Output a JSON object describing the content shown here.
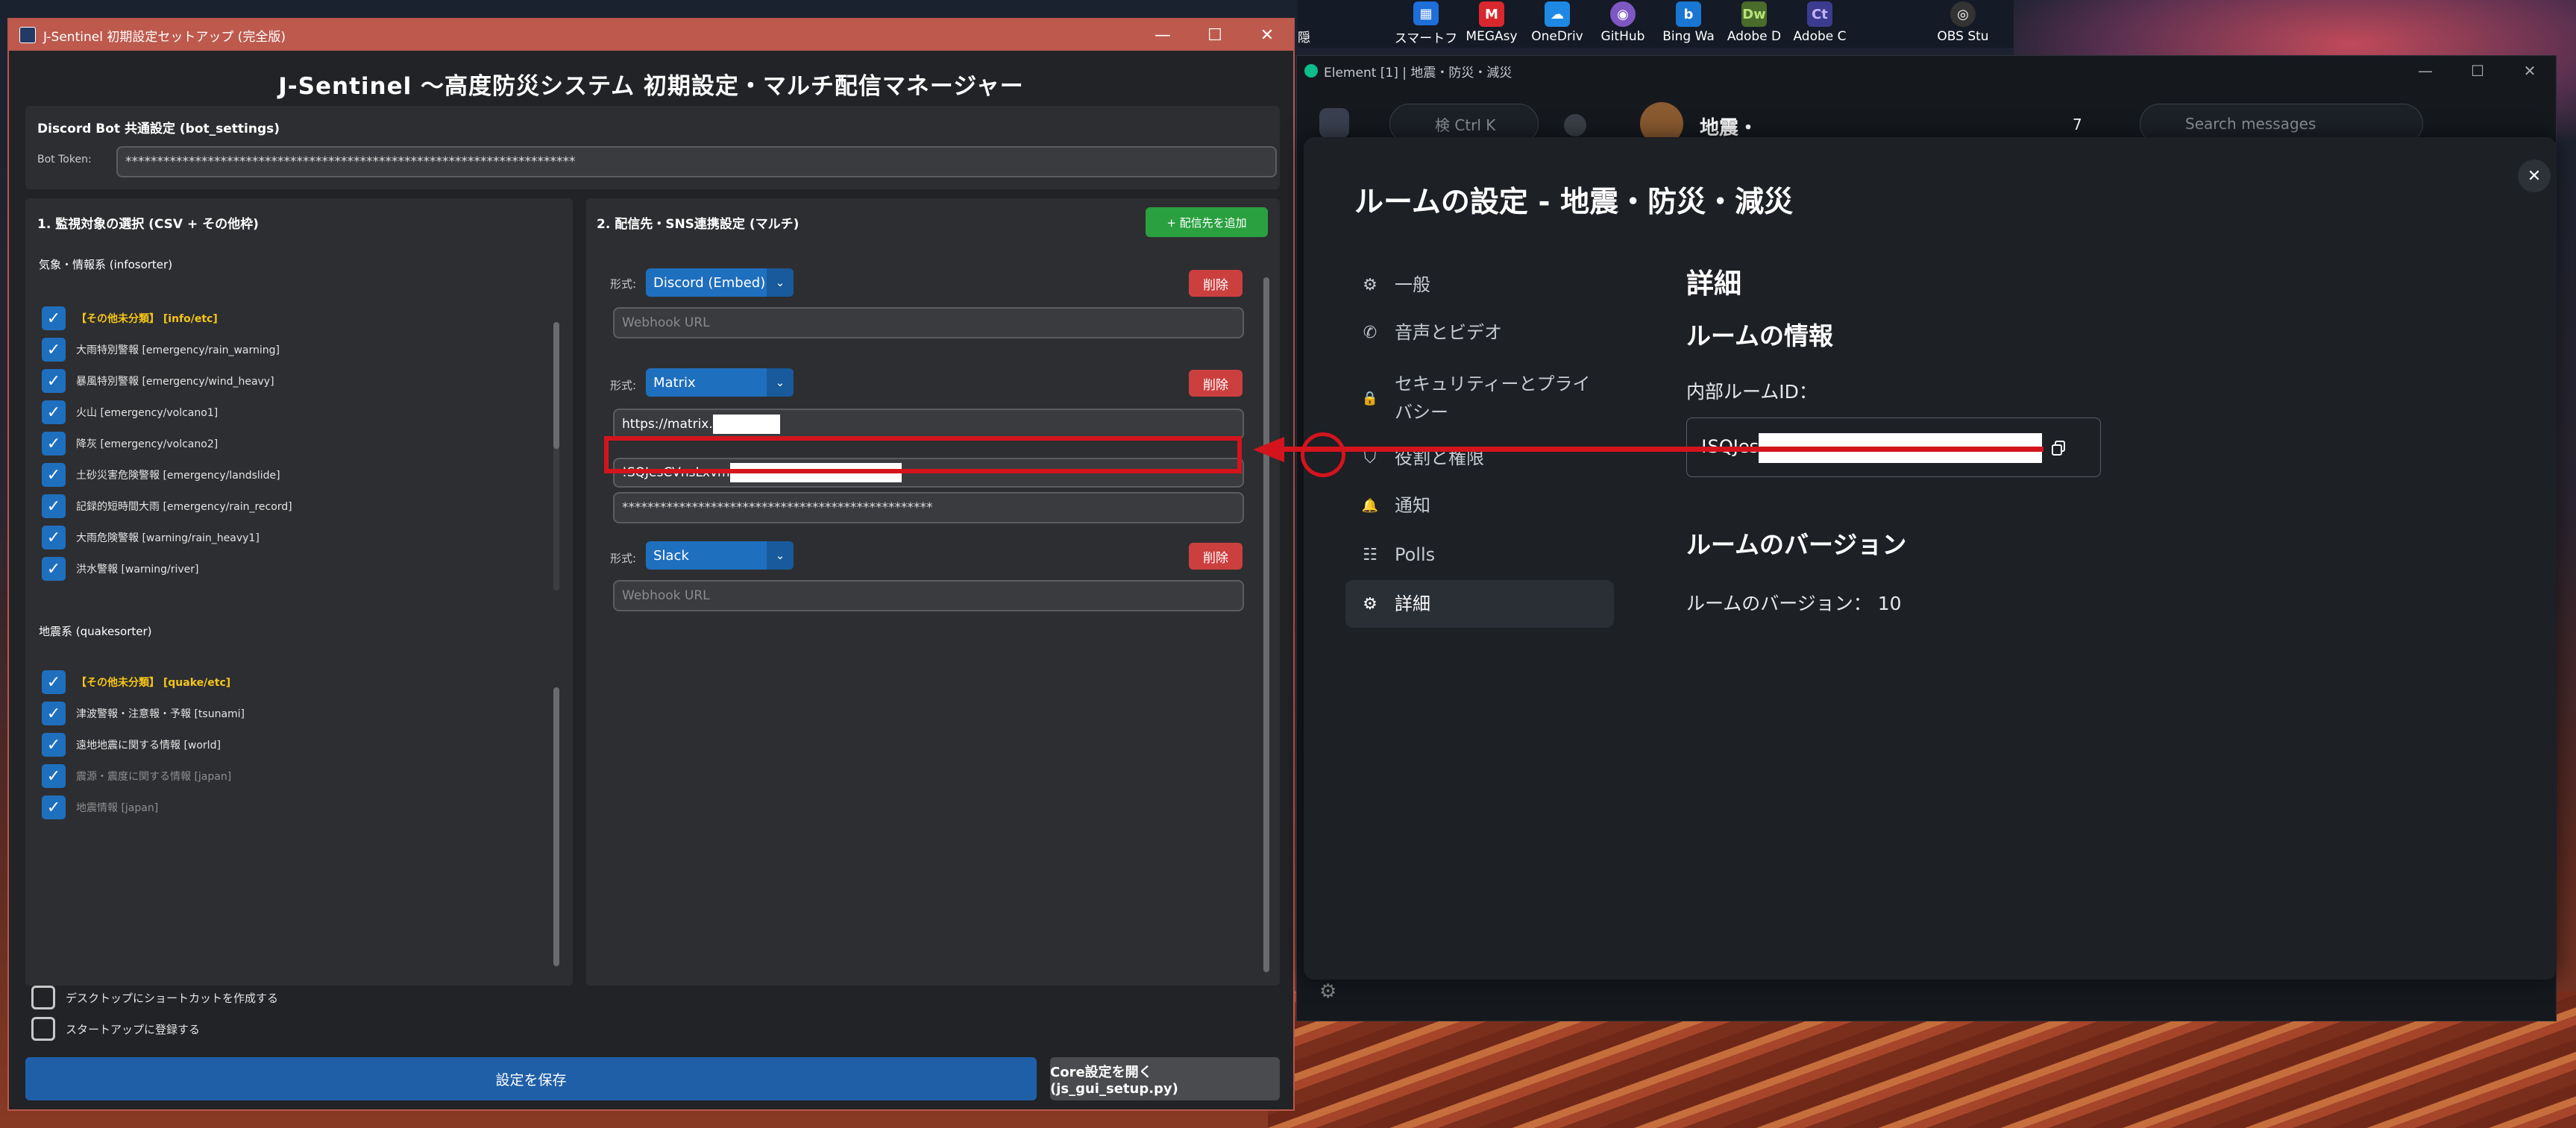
{
  "taskbar": {
    "items": [
      {
        "label": "スマートフ",
        "icon": "smartphone-app-icon",
        "color": "#1e6fd9"
      },
      {
        "label": "MEGAsy",
        "icon": "mega-icon",
        "color": "#d9272e"
      },
      {
        "label": "OneDriv",
        "icon": "onedrive-icon",
        "color": "#1e88e5"
      },
      {
        "label": "GitHub",
        "icon": "github-icon",
        "color": "#7e57c2"
      },
      {
        "label": "Bing Wa",
        "icon": "bing-icon",
        "color": "#1976d2"
      },
      {
        "label": "Adobe D",
        "icon": "dreamweaver-icon",
        "color": "#4a6b2a"
      },
      {
        "label": "Adobe C",
        "icon": "adobe-c-icon",
        "color": "#3b3b8f"
      },
      {
        "label": "OBS Stu",
        "icon": "obs-icon",
        "color": "#333333"
      }
    ],
    "item_glyphs": [
      "▦",
      "M",
      "☁",
      "◉",
      "b",
      "Dw",
      "Ct",
      "◎"
    ],
    "leading_label": "隠"
  },
  "left_window": {
    "title": "J-Sentinel 初期設定セットアップ (完全版)",
    "header": "J-Sentinel 〜高度防災システム 初期設定・マルチ配信マネージャー",
    "bot_settings": {
      "heading": "Discord Bot 共通設定 (bot_settings)",
      "token_label": "Bot Token:",
      "token_value": "***********************************************************************"
    },
    "monitor": {
      "heading": "1. 監視対象の選択 (CSV + その他枠)",
      "weather_group": "気象・情報系 (infosorter)",
      "weather_items": [
        {
          "text": "【その他未分類】 [info/etc]",
          "checked": true
        },
        {
          "text": "大雨特別警報 [emergency/rain_warning]",
          "checked": true
        },
        {
          "text": "暴風特別警報 [emergency/wind_heavy]",
          "checked": true
        },
        {
          "text": "火山 [emergency/volcano1]",
          "checked": true
        },
        {
          "text": "降灰 [emergency/volcano2]",
          "checked": true
        },
        {
          "text": "土砂災害危険警報 [emergency/landslide]",
          "checked": true
        },
        {
          "text": "記録的短時間大雨 [emergency/rain_record]",
          "checked": true
        },
        {
          "text": "大雨危険警報 [warning/rain_heavy1]",
          "checked": true
        },
        {
          "text": "洪水警報 [warning/river]",
          "checked": true
        }
      ],
      "quake_group": "地震系 (quakesorter)",
      "quake_items": [
        {
          "text": "【その他未分類】 [quake/etc]",
          "checked": true
        },
        {
          "text": "津波警報・注意報・予報 [tsunami]",
          "checked": true
        },
        {
          "text": "遠地地震に関する情報 [world]",
          "checked": true
        },
        {
          "text": "震源・震度に関する情報 [japan]",
          "checked": true
        },
        {
          "text": "地震情報 [japan]",
          "checked": true
        }
      ]
    },
    "delivery": {
      "heading": "2. 配信先・SNS連携設定 (マルチ)",
      "add_button": "+ 配信先を追加",
      "format_label": "形式:",
      "delete_label": "削除",
      "entries": [
        {
          "type": "Discord (Embed)",
          "url_placeholder": "Webhook URL"
        },
        {
          "type": "Matrix",
          "homeserver": "https://matrix.",
          "room_id": "!SQJesCVnsLxvm",
          "token": "*************************************************"
        },
        {
          "type": "Slack",
          "url_placeholder": "Webhook URL"
        }
      ]
    },
    "options": {
      "shortcut": "デスクトップにショートカットを作成する",
      "startup": "スタートアップに登録する"
    },
    "save_button": "設定を保存",
    "core_button": "Core設定を開く (js_gui_setup.py)"
  },
  "right_window": {
    "title": "Element [1] | 地震・防災・減災",
    "search_stub": "検  Ctrl K",
    "search_messages": "Search messages",
    "room_name_stub": "地震・",
    "member_count": "7",
    "dialog": {
      "title": "ルームの設定 - 地震・防災・減災",
      "nav": [
        {
          "label": "一般",
          "icon": "gear-icon",
          "glyph": "⚙"
        },
        {
          "label": "音声とビデオ",
          "icon": "phone-icon",
          "glyph": "✆"
        },
        {
          "label": "セキュリティーとプライバシー",
          "icon": "lock-icon",
          "glyph": "🔒"
        },
        {
          "label": "役割と権限",
          "icon": "shield-icon",
          "glyph": "⛉"
        },
        {
          "label": "通知",
          "icon": "bell-icon",
          "glyph": "🔔"
        },
        {
          "label": "Polls",
          "icon": "polls-icon",
          "glyph": "☷"
        },
        {
          "label": "詳細",
          "icon": "advanced-icon",
          "glyph": "⚙"
        }
      ],
      "active_nav": "詳細",
      "details_heading": "詳細",
      "room_info_heading": "ルームの情報",
      "internal_id_label": "内部ルームID：",
      "internal_id_value": "!SQJes",
      "version_heading": "ルームのバージョン",
      "version_text": "ルームのバージョン： 10"
    }
  },
  "annotation": {
    "color": "#d4141c"
  }
}
